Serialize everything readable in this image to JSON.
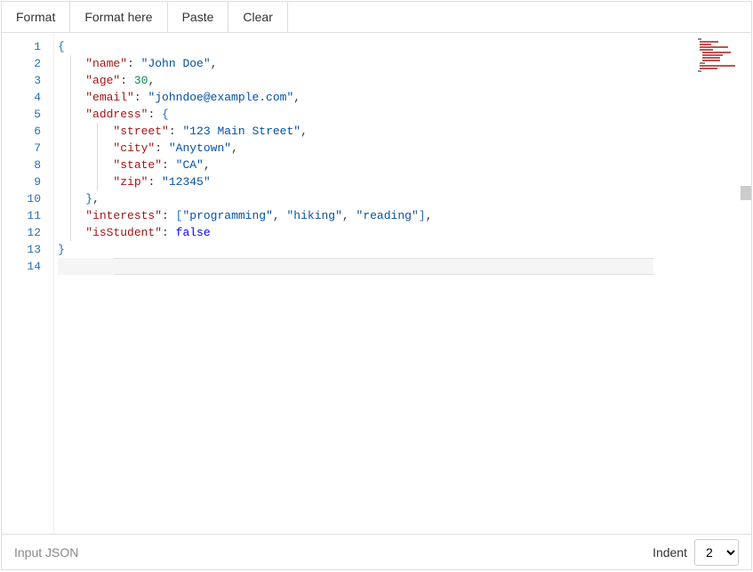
{
  "toolbar": {
    "format": "Format",
    "format_here": "Format here",
    "paste": "Paste",
    "clear": "Clear"
  },
  "editor": {
    "line_numbers": [
      "1",
      "2",
      "3",
      "4",
      "5",
      "6",
      "7",
      "8",
      "9",
      "10",
      "11",
      "12",
      "13",
      "14"
    ],
    "active_line": 14,
    "code_tokens": [
      [
        {
          "t": "{",
          "c": "brace"
        }
      ],
      [
        {
          "t": "    ",
          "c": "ws"
        },
        {
          "t": "\"name\"",
          "c": "key"
        },
        {
          "t": ": ",
          "c": "punc"
        },
        {
          "t": "\"John Doe\"",
          "c": "str"
        },
        {
          "t": ",",
          "c": "punc"
        }
      ],
      [
        {
          "t": "    ",
          "c": "ws"
        },
        {
          "t": "\"age\"",
          "c": "key"
        },
        {
          "t": ": ",
          "c": "punc"
        },
        {
          "t": "30",
          "c": "num"
        },
        {
          "t": ",",
          "c": "punc"
        }
      ],
      [
        {
          "t": "    ",
          "c": "ws"
        },
        {
          "t": "\"email\"",
          "c": "key"
        },
        {
          "t": ": ",
          "c": "punc"
        },
        {
          "t": "\"johndoe@example.com\"",
          "c": "str"
        },
        {
          "t": ",",
          "c": "punc"
        }
      ],
      [
        {
          "t": "    ",
          "c": "ws"
        },
        {
          "t": "\"address\"",
          "c": "key"
        },
        {
          "t": ": ",
          "c": "punc"
        },
        {
          "t": "{",
          "c": "brace"
        }
      ],
      [
        {
          "t": "        ",
          "c": "ws"
        },
        {
          "t": "\"street\"",
          "c": "key"
        },
        {
          "t": ": ",
          "c": "punc"
        },
        {
          "t": "\"123 Main Street\"",
          "c": "str"
        },
        {
          "t": ",",
          "c": "punc"
        }
      ],
      [
        {
          "t": "        ",
          "c": "ws"
        },
        {
          "t": "\"city\"",
          "c": "key"
        },
        {
          "t": ": ",
          "c": "punc"
        },
        {
          "t": "\"Anytown\"",
          "c": "str"
        },
        {
          "t": ",",
          "c": "punc"
        }
      ],
      [
        {
          "t": "        ",
          "c": "ws"
        },
        {
          "t": "\"state\"",
          "c": "key"
        },
        {
          "t": ": ",
          "c": "punc"
        },
        {
          "t": "\"CA\"",
          "c": "str"
        },
        {
          "t": ",",
          "c": "punc"
        }
      ],
      [
        {
          "t": "        ",
          "c": "ws"
        },
        {
          "t": "\"zip\"",
          "c": "key"
        },
        {
          "t": ": ",
          "c": "punc"
        },
        {
          "t": "\"12345\"",
          "c": "str"
        }
      ],
      [
        {
          "t": "    ",
          "c": "ws"
        },
        {
          "t": "}",
          "c": "brace"
        },
        {
          "t": ",",
          "c": "punc"
        }
      ],
      [
        {
          "t": "    ",
          "c": "ws"
        },
        {
          "t": "\"interests\"",
          "c": "key"
        },
        {
          "t": ": ",
          "c": "punc"
        },
        {
          "t": "[",
          "c": "brace"
        },
        {
          "t": "\"programming\"",
          "c": "str"
        },
        {
          "t": ", ",
          "c": "punc"
        },
        {
          "t": "\"hiking\"",
          "c": "str"
        },
        {
          "t": ", ",
          "c": "punc"
        },
        {
          "t": "\"reading\"",
          "c": "str"
        },
        {
          "t": "]",
          "c": "brace"
        },
        {
          "t": ",",
          "c": "punc"
        }
      ],
      [
        {
          "t": "    ",
          "c": "ws"
        },
        {
          "t": "\"isStudent\"",
          "c": "key"
        },
        {
          "t": ": ",
          "c": "punc"
        },
        {
          "t": "false",
          "c": "bool"
        }
      ],
      [
        {
          "t": "}",
          "c": "brace"
        }
      ],
      []
    ],
    "minimap_colors": [
      "#888",
      "#b55",
      "#b55",
      "#b55",
      "#b55",
      "#b55",
      "#b55",
      "#b55",
      "#b55",
      "#888",
      "#b55",
      "#b55",
      "#888"
    ]
  },
  "footer": {
    "label": "Input JSON",
    "indent_label": "Indent",
    "indent_value": "2"
  }
}
